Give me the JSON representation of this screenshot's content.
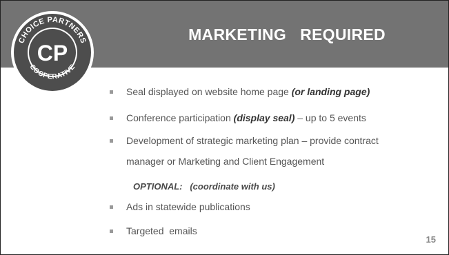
{
  "slide": {
    "title": "MARKETING   REQUIRED",
    "logo": {
      "ring_text_top": "CHOICE PARTNERS",
      "ring_text_bottom": "COOPERATIVE",
      "monogram": "CP"
    },
    "bullets": [
      {
        "parts": [
          "Seal displayed on website home page ",
          "(or landing page)"
        ]
      },
      {
        "parts": [
          "Conference participation ",
          "(display seal)",
          " – up to 5 events"
        ]
      },
      {
        "line1": "Development of strategic marketing plan – provide contract",
        "line2": "manager or Marketing and Client Engagement"
      },
      {
        "text": "Ads in statewide publications"
      },
      {
        "text": "Targeted  emails"
      }
    ],
    "optional": {
      "label": "OPTIONAL:",
      "note": "(coordinate with us)"
    },
    "page_number": "15"
  },
  "colors": {
    "title_bar": "#737373",
    "slide_background": "#ffffff",
    "body_text": "#555555",
    "bullet_marker": "#999999"
  }
}
